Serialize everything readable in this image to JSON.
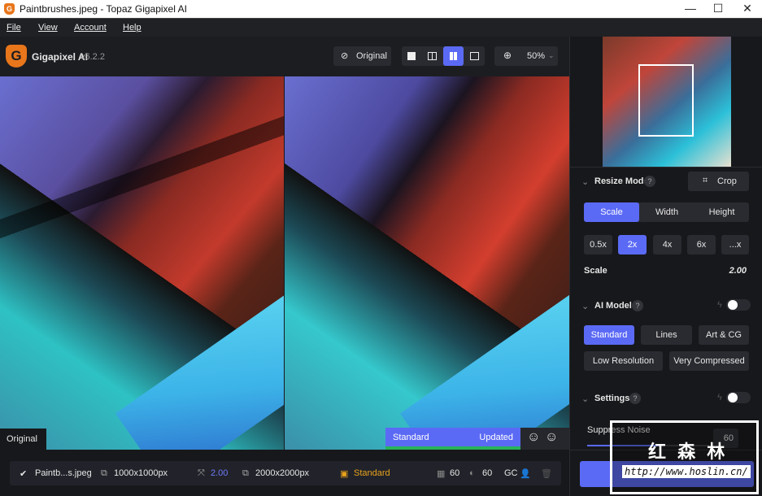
{
  "window": {
    "title": "Paintbrushes.jpeg - Topaz Gigapixel AI",
    "minimize": "—",
    "maximize": "☐",
    "close": "✕"
  },
  "menu": [
    "File",
    "View",
    "Account",
    "Help"
  ],
  "toolbar": {
    "app_name": "Gigapixel AI",
    "version": "v6.2.2",
    "original_label": "Original",
    "zoom": "50%"
  },
  "preview": {
    "left_label": "Original",
    "model_label": "Standard",
    "model_status": "Updated"
  },
  "status": {
    "file": "Paintb...s.jpeg",
    "input_size": "1000x1000px",
    "scale": "2.00",
    "output_size": "2000x2000px",
    "model": "Standard",
    "noise": "60",
    "blur": "60",
    "gc": "GC"
  },
  "panel": {
    "resize_mode": {
      "title": "Resize Mode",
      "help": "?",
      "crop": "Crop",
      "tabs": [
        "Scale",
        "Width",
        "Height"
      ],
      "active_tab": "Scale",
      "presets": [
        "0.5x",
        "2x",
        "4x",
        "6x",
        "...x"
      ],
      "active_preset": "2x",
      "scale_label": "Scale",
      "scale_value": "2.00"
    },
    "ai_model": {
      "title": "AI Model",
      "help": "?",
      "models": [
        "Standard",
        "Lines",
        "Art & CG",
        "Low Resolution",
        "Very Compressed"
      ],
      "active": "Standard",
      "auto_enabled": false
    },
    "settings": {
      "title": "Settings",
      "help": "?",
      "auto_enabled": false,
      "suppress_noise_label": "Suppress Noise",
      "suppress_noise_value": "60",
      "suppress_noise_level": 60
    }
  },
  "watermark": {
    "text": "红 森 林",
    "url": "http://www.hoslin.cn/"
  },
  "colors": {
    "accent": "#5b6af5",
    "orange": "#e8a21b",
    "green": "#27b35a"
  }
}
